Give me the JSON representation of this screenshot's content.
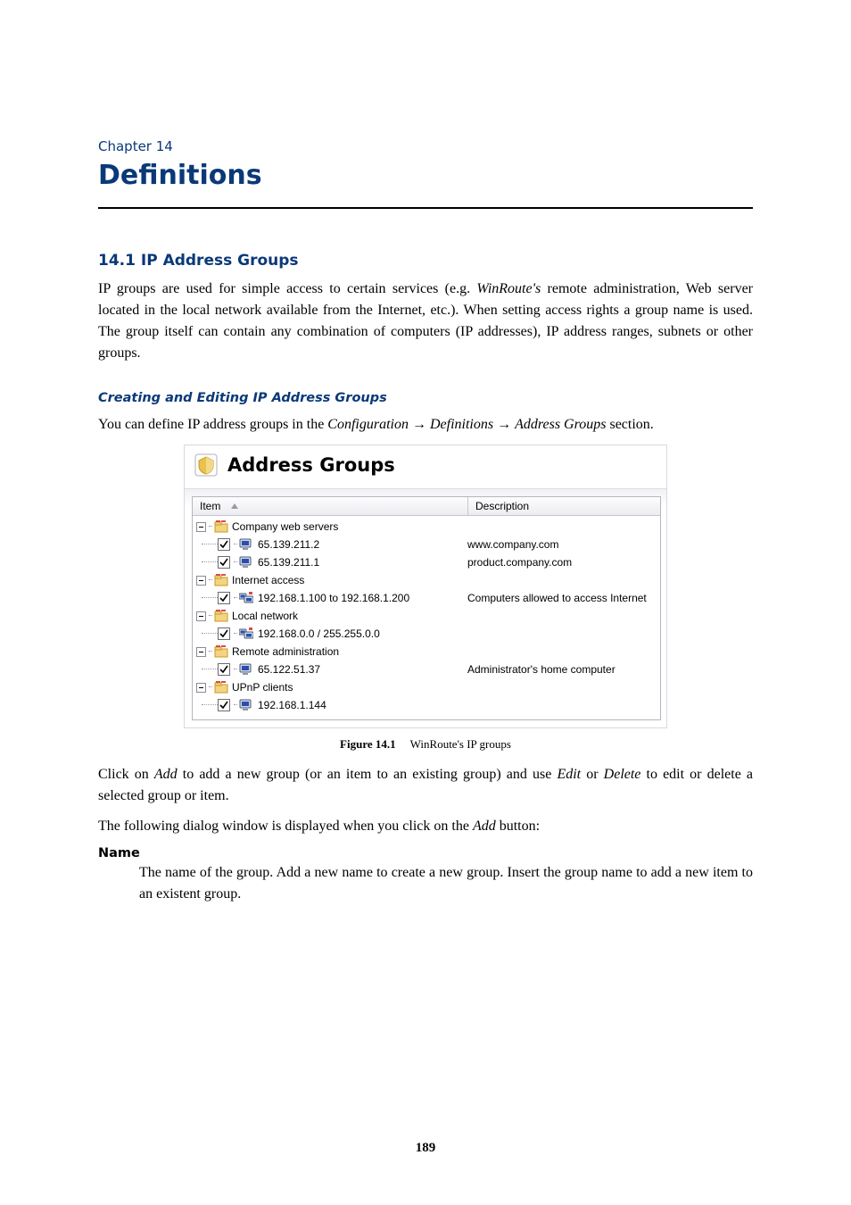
{
  "chapter_label": "Chapter 14",
  "chapter_title": "Definitions",
  "section_title": "14.1  IP Address Groups",
  "intro_para": "IP groups are used for simple access to certain services (e.g. WinRoute's remote administration, Web server located in the local network available from the Internet, etc.). When setting access rights a group name is used. The group itself can contain any combination of computers (IP addresses), IP address ranges, subnets or other groups.",
  "intro_para_plain_pre": "IP groups are used for simple access to certain services (e.g. ",
  "intro_para_italic1": "WinRoute's",
  "intro_para_plain_post": " remote administration, Web server located in the local network available from the Internet, etc.). When setting access rights a group name is used. The group itself can contain any combination of computers (IP addresses), IP address ranges, subnets or other groups.",
  "subsection_title": "Creating and Editing IP Address Groups",
  "nav_para_pre": "You can define IP address groups in the ",
  "nav_conf": "Configuration",
  "nav_defs": "Definitions",
  "nav_addr": "Address Groups",
  "nav_para_post": " section.",
  "figure": {
    "panel_title": "Address Groups",
    "col_item": "Item",
    "col_desc": "Description",
    "groups": [
      {
        "name": "Company web servers",
        "items": [
          {
            "kind": "host",
            "checked": true,
            "label": "65.139.211.2",
            "desc": "www.company.com"
          },
          {
            "kind": "host",
            "checked": true,
            "label": "65.139.211.1",
            "desc": "product.company.com"
          }
        ]
      },
      {
        "name": "Internet access",
        "items": [
          {
            "kind": "range",
            "checked": true,
            "label": "192.168.1.100 to 192.168.1.200",
            "desc": "Computers allowed to access Internet"
          }
        ]
      },
      {
        "name": "Local network",
        "items": [
          {
            "kind": "subnet",
            "checked": true,
            "label": "192.168.0.0 / 255.255.0.0",
            "desc": ""
          }
        ]
      },
      {
        "name": "Remote administration",
        "items": [
          {
            "kind": "host",
            "checked": true,
            "label": "65.122.51.37",
            "desc": "Administrator's home computer"
          }
        ]
      },
      {
        "name": "UPnP clients",
        "items": [
          {
            "kind": "host",
            "checked": true,
            "label": "192.168.1.144",
            "desc": ""
          }
        ]
      }
    ],
    "caption_lead": "Figure 14.1",
    "caption_rest": "WinRoute's IP groups"
  },
  "post_fig_para_pre": "Click on ",
  "post_fig_add": "Add",
  "post_fig_mid1": " to add a new group (or an item to an existing group) and use ",
  "post_fig_edit": "Edit",
  "post_fig_or": " or ",
  "post_fig_delete": "Delete",
  "post_fig_post": " to edit or delete a selected group or item.",
  "dialog_intro_pre": "The following dialog window is displayed when you click on the ",
  "dialog_intro_add": "Add",
  "dialog_intro_post": " button:",
  "term_name": "Name",
  "term_desc": "The name of the group. Add a new name to create a new group. Insert the group name to add a new item to an existent group.",
  "page_number": "189"
}
